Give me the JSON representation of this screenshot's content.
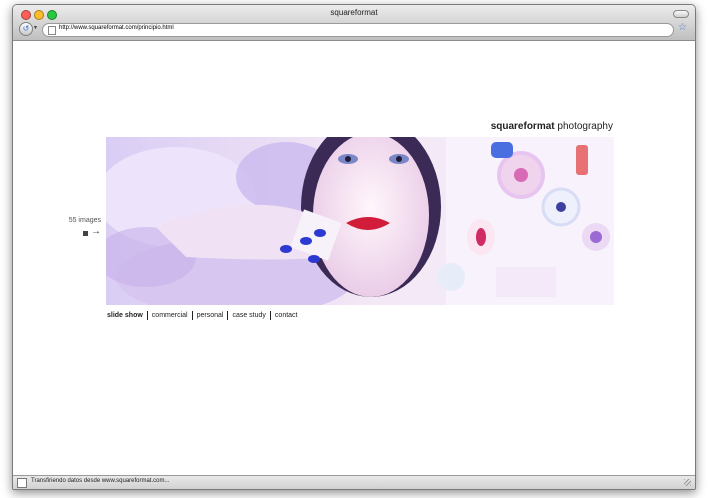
{
  "window": {
    "title": "squareformat"
  },
  "toolbar": {
    "url": "http://www.squareformat.com/principio.html"
  },
  "page": {
    "brand_bold": "squareformat",
    "brand_light": " photography",
    "image_count": "55 images",
    "nav": [
      {
        "label": "slide show"
      },
      {
        "label": "commercial"
      },
      {
        "label": "personal"
      },
      {
        "label": "case study"
      },
      {
        "label": "contact"
      }
    ]
  },
  "statusbar": {
    "text": "Transfiriendo datos desde www.squareformat.com..."
  },
  "colors": {
    "close": "#ff5f57",
    "minimize": "#ffbd2e",
    "zoom": "#28c940",
    "accent": "#4a7fd4"
  }
}
